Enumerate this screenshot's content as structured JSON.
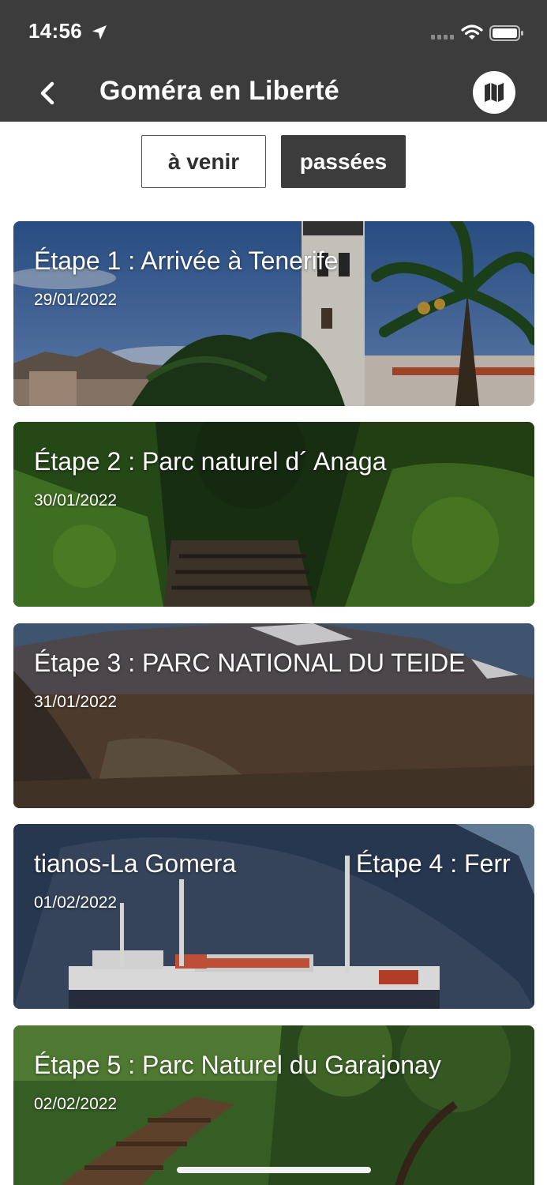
{
  "status_bar": {
    "time": "14:56"
  },
  "header": {
    "title": "Goméra en Liberté",
    "back_icon": "chevron-left-icon",
    "map_icon": "map-icon"
  },
  "tabs": [
    {
      "label": "à venir",
      "selected": false
    },
    {
      "label": "passées",
      "selected": true
    }
  ],
  "stages": [
    {
      "title": "Étape 1 : Arrivée à Tenerife",
      "date": "29/01/2022",
      "image": "church-tower-palm-trees"
    },
    {
      "title": "Étape 2 : Parc naturel d´ Anaga",
      "date": "30/01/2022",
      "image": "forest-stone-path"
    },
    {
      "title": "Étape 3 : PARC NATIONAL DU TEIDE",
      "date": "31/01/2022",
      "image": "volcano-landscape"
    },
    {
      "title_left": "tianos-La Gomera",
      "title_right": "Étape 4 : Ferr",
      "date": "01/02/2022",
      "image": "ferry-cliff"
    },
    {
      "title": "Étape 5 : Parc Naturel du Garajonay",
      "date": "02/02/2022",
      "image": "green-forest-steps"
    }
  ],
  "colors": {
    "header_bg": "#3c3c3c",
    "tab_selected_bg": "#3c3c3c",
    "text_on_dark": "#ffffff"
  }
}
